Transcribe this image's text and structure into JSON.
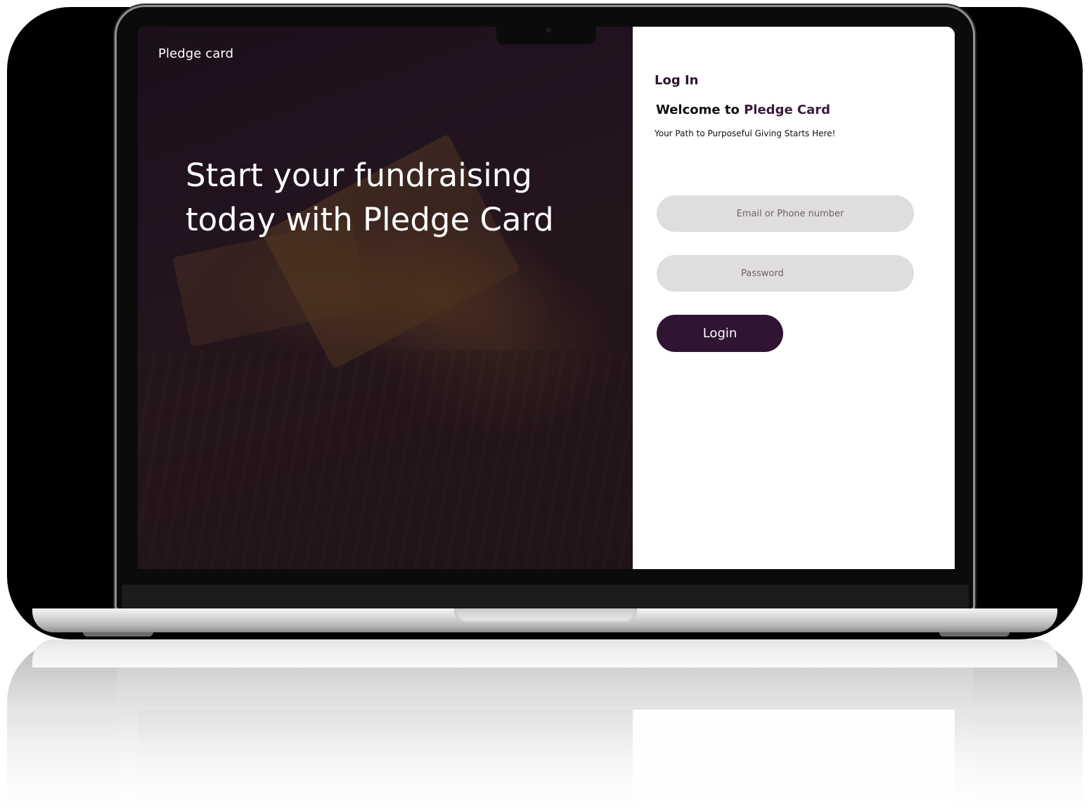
{
  "app": {
    "brand": "Pledge card",
    "headline": "Start your fundraising today with Pledge Card"
  },
  "login": {
    "heading": "Log In",
    "welcome_prefix": "Welcome to ",
    "welcome_brand": "Pledge Card",
    "tagline": "Your Path to Purposeful Giving Starts Here!",
    "email_placeholder": "Email or Phone number",
    "email_value": "",
    "password_placeholder": "Password",
    "password_value": "",
    "button_label": "Login"
  },
  "colors": {
    "accent": "#2f1532",
    "field_bg": "#e0dde0",
    "panel_bg": "#ffffff"
  }
}
